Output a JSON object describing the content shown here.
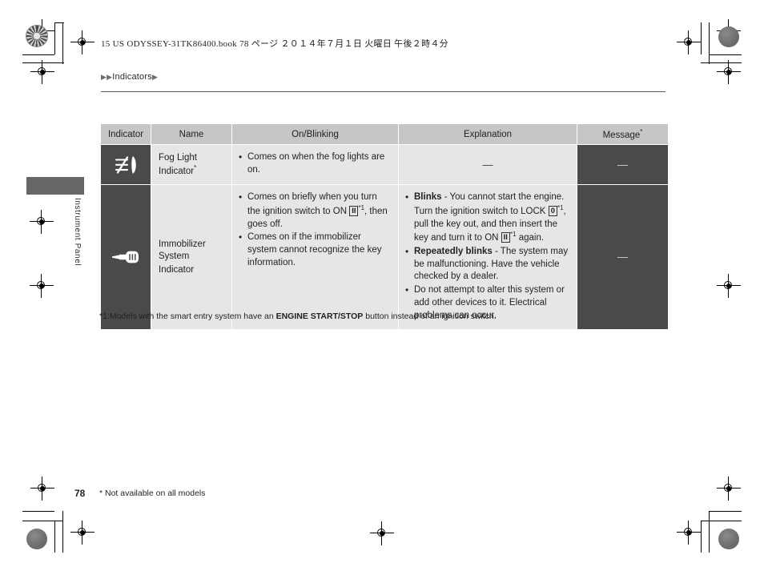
{
  "print": {
    "book_header": "15 US ODYSSEY-31TK86400.book   78 ページ   ２０１４年７月１日   火曜日   午後２時４分"
  },
  "breadcrumb": {
    "arrows_before": "▶▶",
    "label": "Indicators",
    "arrow_after": "▶"
  },
  "side_tab": {
    "label": "Instrument Panel"
  },
  "table": {
    "headers": [
      {
        "label": "Indicator",
        "sup": ""
      },
      {
        "label": "Name",
        "sup": ""
      },
      {
        "label": "On/Blinking",
        "sup": ""
      },
      {
        "label": "Explanation",
        "sup": ""
      },
      {
        "label": "Message",
        "sup": "*"
      }
    ],
    "rows": [
      {
        "icon": "fog-light-icon",
        "name": "Fog Light Indicator",
        "name_sup": "*",
        "on_blinking": [
          {
            "text": "Comes on when the fog lights are on."
          }
        ],
        "explanation_dash": "—",
        "message_dash": "—"
      },
      {
        "icon": "immobilizer-key-icon",
        "name": "Immobilizer System Indicator",
        "name_sup": "",
        "on_blinking": [
          {
            "pre": "Comes on briefly when you turn the ignition switch to ON ",
            "key": "II",
            "key_sup": "*1",
            "post": ", then goes off."
          },
          {
            "text": "Comes on if the immobilizer system cannot recognize the key information."
          }
        ],
        "explanation": [
          {
            "lead": "Blinks",
            "pre": " - You cannot start the engine. Turn the ignition switch to LOCK ",
            "key": "0",
            "key_sup": "*1",
            "mid": ", pull the key out, and then insert the key and turn it to ON ",
            "key2": "II",
            "key2_sup": "*1",
            "post": " again."
          },
          {
            "lead": "Repeatedly blinks",
            "pre": " - The system may be malfunctioning. Have the vehicle checked by a dealer."
          },
          {
            "pre": "Do not attempt to alter this system or add other devices to it. Electrical problems can occur."
          }
        ],
        "message_dash": "—"
      }
    ]
  },
  "footnote": {
    "prefix": "*1:Models with the smart entry system have an ",
    "bold": "ENGINE START/STOP",
    "suffix": " button instead of an ignition switch."
  },
  "page_footer": {
    "number": "78",
    "note": "* Not available on all models"
  },
  "colors": {
    "header_fill": "#c6c6c6",
    "cell_fill": "#e6e6e6",
    "dark_fill": "#4a4a4a",
    "tab_fill": "#666666",
    "text": "#231f20"
  }
}
